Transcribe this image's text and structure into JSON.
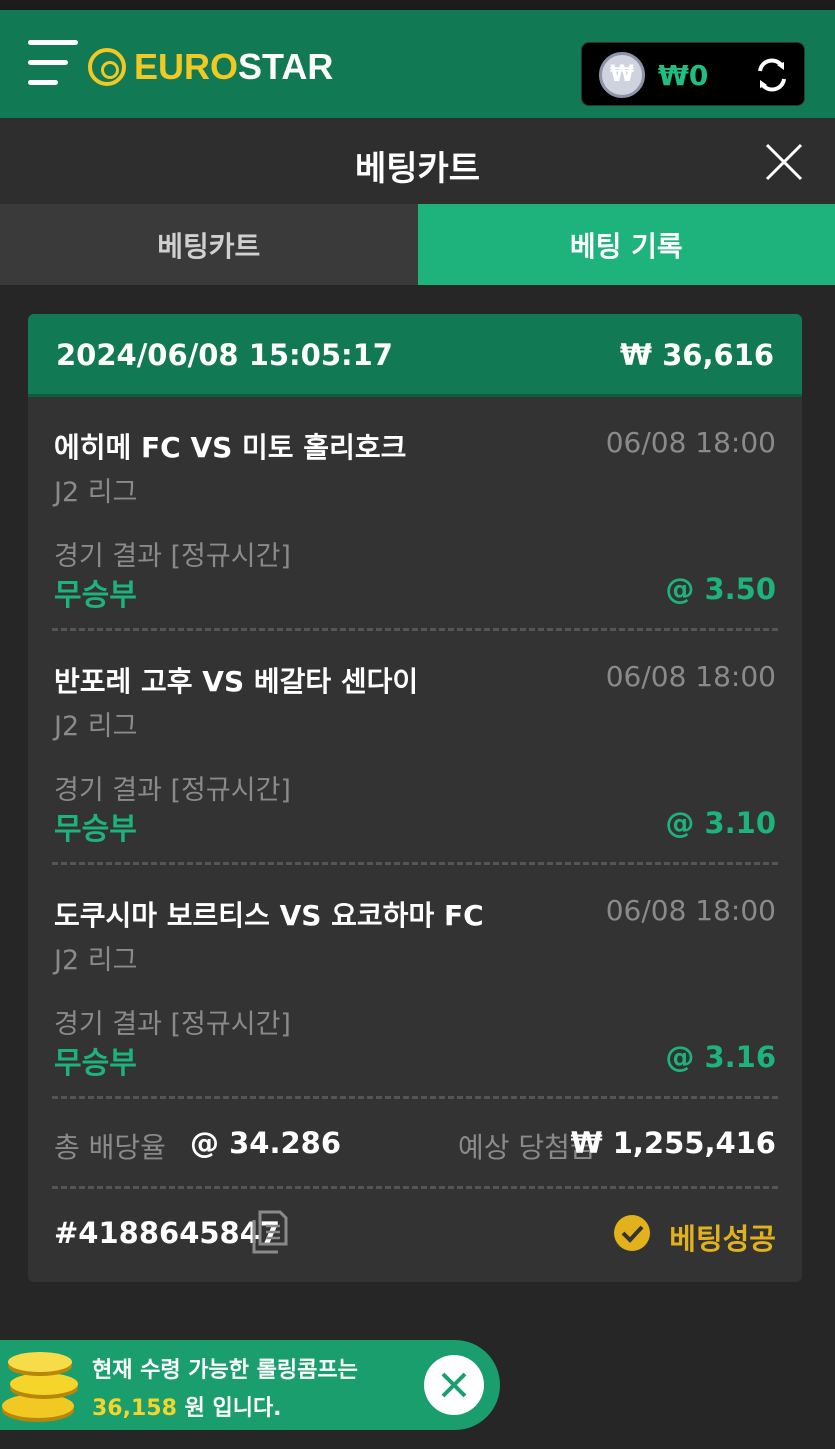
{
  "header": {
    "logo_euro": "EURO",
    "logo_star": "STAR",
    "currency_symbol": "₩",
    "balance": "₩0",
    "icons": [
      "menu-icon",
      "won-coin-icon",
      "refresh-icon"
    ],
    "brand_color": "#117a55"
  },
  "titlebar": {
    "title": "베팅카트"
  },
  "tabs": [
    {
      "label": "베팅카트",
      "active": false
    },
    {
      "label": "베팅 기록",
      "active": true
    }
  ],
  "slip": {
    "datetime": "2024/06/08 15:05:17",
    "stake": "₩ 36,616",
    "bets": [
      {
        "match": "에히메 FC VS 미토 홀리호크",
        "time": "06/08 18:00",
        "league": "J2 리그",
        "market": "경기 결과 [정규시간]",
        "pick": "무승부",
        "odds": "@ 3.50"
      },
      {
        "match": "반포레 고후 VS 베갈타 센다이",
        "time": "06/08 18:00",
        "league": "J2 리그",
        "market": "경기 결과 [정규시간]",
        "pick": "무승부",
        "odds": "@ 3.10"
      },
      {
        "match": "도쿠시마 보르티스 VS 요코하마 FC",
        "time": "06/08 18:00",
        "league": "J2 리그",
        "market": "경기 결과 [정규시간]",
        "pick": "무승부",
        "odds": "@ 3.16"
      }
    ],
    "total_odds_label": "총 배당율",
    "total_odds": "@ 34.286",
    "expected_win_label": "예상 당첨금",
    "expected_win": "₩ 1,255,416",
    "bet_id": "#4188645847",
    "status": "베팅성공",
    "status_color": "#e1b21c",
    "accent_color": "#1eb27d"
  },
  "promo": {
    "line1": "현재 수령 가능한 롤링콤프는",
    "amount": "36,158",
    "line2_suffix": " 원 입니다."
  }
}
